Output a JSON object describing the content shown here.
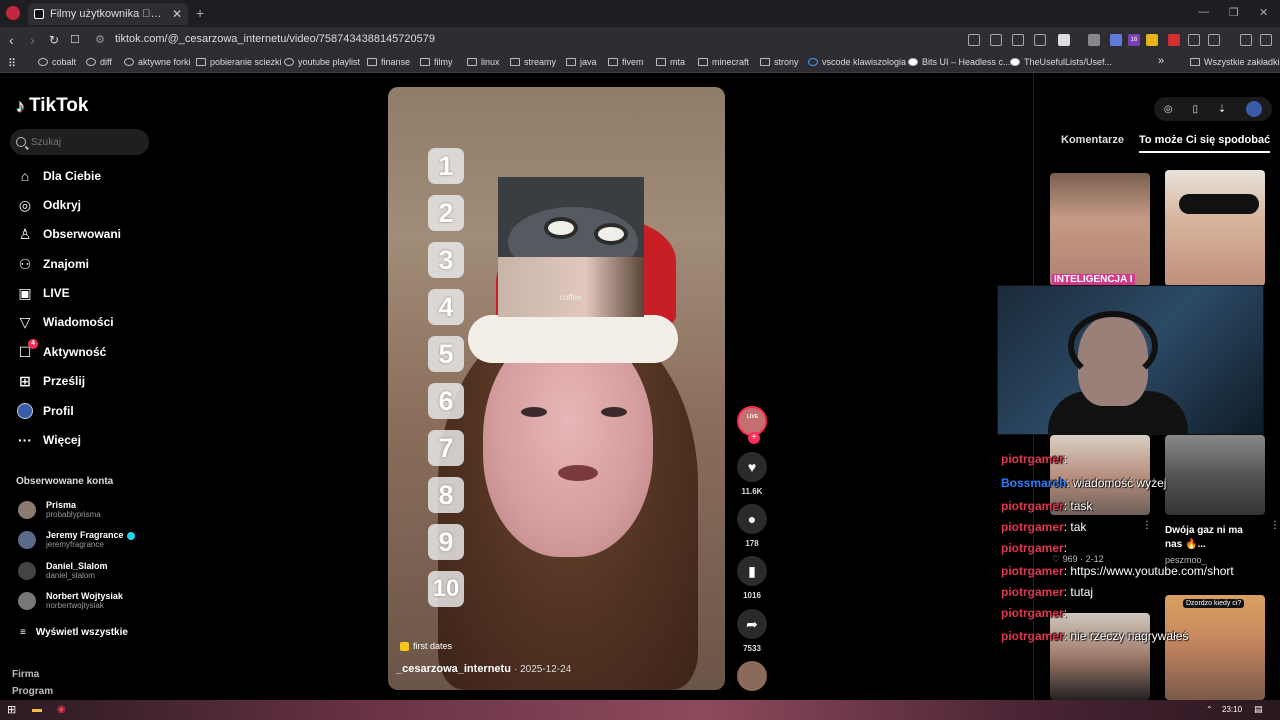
{
  "browser": {
    "tab_title": "Filmy użytkownika \u0000Cesarzowa_Internetu",
    "url": "tiktok.com/@_cesarzowa_internetu/video/7587434388145720579",
    "bookmarks": [
      "cobalt",
      "diff",
      "aktywne forki",
      "pobieranie sciezki",
      "youtube playlist",
      "finanse",
      "filmy",
      "linux",
      "streamy",
      "java",
      "fivem",
      "mta",
      "minecraft",
      "strony",
      "vscode klawiszologia",
      "Bits UI – Headless c...",
      "TheUsefulLists/Usef..."
    ],
    "bookmarks_more": "»",
    "all_bookmarks": "Wszystkie zakładki",
    "ext_badge": "16"
  },
  "sidebar": {
    "logo": "TikTok",
    "search_placeholder": "Szukaj",
    "nav": [
      {
        "label": "Dla Ciebie",
        "icon": "home-icon"
      },
      {
        "label": "Odkryj",
        "icon": "compass-icon"
      },
      {
        "label": "Obserwowani",
        "icon": "following-icon"
      },
      {
        "label": "Znajomi",
        "icon": "friends-icon"
      },
      {
        "label": "LIVE",
        "icon": "live-icon"
      },
      {
        "label": "Wiadomości",
        "icon": "messages-icon"
      },
      {
        "label": "Aktywność",
        "icon": "activity-icon",
        "badge": "4"
      },
      {
        "label": "Prześlij",
        "icon": "upload-icon"
      },
      {
        "label": "Profil",
        "icon": "profile-icon"
      },
      {
        "label": "Więcej",
        "icon": "more-icon"
      }
    ],
    "followed_title": "Obserwowane konta",
    "accounts": [
      {
        "name": "Prisma",
        "handle": "probablyprisma",
        "verified": false
      },
      {
        "name": "Jeremy Fragrance",
        "handle": "jeremyfragrance",
        "verified": true
      },
      {
        "name": "Daniel_Slalom",
        "handle": "daniel_slalom",
        "verified": false
      },
      {
        "name": "Norbert Wojtysiak",
        "handle": "norbertwojtysiak",
        "verified": false
      }
    ],
    "see_all": "Wyświetl wszystkie",
    "footer": [
      "Firma",
      "Program"
    ]
  },
  "video": {
    "numbers": [
      "1",
      "2",
      "3",
      "4",
      "5",
      "6",
      "7",
      "8",
      "9",
      "10"
    ],
    "photo_caption": "coffee",
    "tag": "first dates",
    "author": "_cesarzowa_internetu",
    "date": "2025-12-24",
    "live_label": "LIVE",
    "likes": "11.6K",
    "comments": "178",
    "saves": "1016",
    "shares": "7533"
  },
  "right_panel": {
    "tabs": [
      "Komentarze",
      "To może Ci się spodobać"
    ],
    "active_tab": 1,
    "thumb_overlay_text": "INTELIGENCJA I",
    "items": [
      {
        "title": "Dwója gaz ni ma nas 🔥...",
        "user": "peszmoo_",
        "overlay": ""
      },
      {
        "title": "",
        "user": "",
        "overlay": "Dzordzo kiedy ci?"
      }
    ],
    "stats": "♡ 969 · 2-12"
  },
  "stream_chat": [
    {
      "user": "piotrgamer",
      "msg": ":",
      "blue": false
    },
    {
      "user": "Bossmarch",
      "msg": ": wiadomość wyżej",
      "blue": true
    },
    {
      "user": "piotrgamer",
      "msg": ": task",
      "blue": false
    },
    {
      "user": "piotrgamer",
      "msg": ": tak",
      "blue": false
    },
    {
      "user": "piotrgamer",
      "msg": ":",
      "blue": false
    },
    {
      "user": "piotrgamer",
      "msg": ": https://www.youtube.com/short",
      "blue": false
    },
    {
      "user": "piotrgamer",
      "msg": ": tutaj",
      "blue": false
    },
    {
      "user": "piotrgamer",
      "msg": ":",
      "blue": false
    },
    {
      "user": "piotrgamer",
      "msg": ": nie rzeczy nagrywałeś",
      "blue": false
    }
  ],
  "taskbar": {
    "time": "23:10"
  }
}
